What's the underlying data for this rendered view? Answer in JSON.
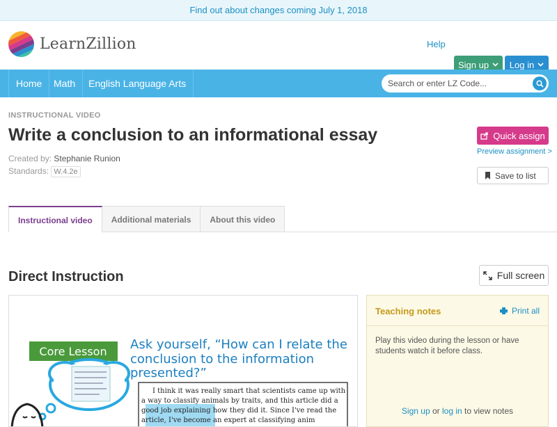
{
  "banner": {
    "text": "Find out about changes coming July 1, 2018"
  },
  "header": {
    "logo_text": "LearnZillion",
    "help": "Help",
    "signup": "Sign up",
    "login": "Log in"
  },
  "nav": {
    "items": [
      {
        "label": "Home"
      },
      {
        "label": "Math"
      },
      {
        "label": "English Language Arts"
      }
    ],
    "search_placeholder": "Search or enter LZ Code..."
  },
  "lesson": {
    "eyebrow": "INSTRUCTIONAL VIDEO",
    "title": "Write a conclusion to an informational essay",
    "created_by_label": "Created by:",
    "created_by": "Stephanie Runion",
    "standards_label": "Standards:",
    "standard": "W.4.2e"
  },
  "actions": {
    "quick_assign": "Quick assign",
    "preview": "Preview assignment >",
    "save_to_list": "Save to list"
  },
  "tabs": [
    {
      "label": "Instructional video",
      "active": true
    },
    {
      "label": "Additional materials",
      "active": false
    },
    {
      "label": "About this video",
      "active": false
    }
  ],
  "section": {
    "title": "Direct Instruction",
    "full_screen": "Full screen"
  },
  "video": {
    "badge": "Core Lesson",
    "heading_lines": [
      "Ask yourself, “How can I relate the",
      "conclusion to the information",
      "presented?”"
    ],
    "body_lines": [
      "I think it was really smart that scientists came up with",
      "a way to classify animals by traits, and this article did a",
      "good job explaining how they did it.  Since I've read the",
      "article, I've become an expert at classifying anim"
    ]
  },
  "notes": {
    "title": "Teaching notes",
    "print_all": "Print all",
    "body": "Play this video during the lesson or have students watch it before class.",
    "sign_up": "Sign up",
    "or": "or",
    "log_in": "log in",
    "to_view": "to view notes"
  },
  "colors": {
    "nav_blue": "#4ab3e6",
    "signup_green": "#3d9e77",
    "login_blue": "#2a8fd0",
    "quick_assign_pink": "#d63a8a",
    "active_tab_purple": "#7b3e8e",
    "notes_gold": "#c59a1c"
  }
}
